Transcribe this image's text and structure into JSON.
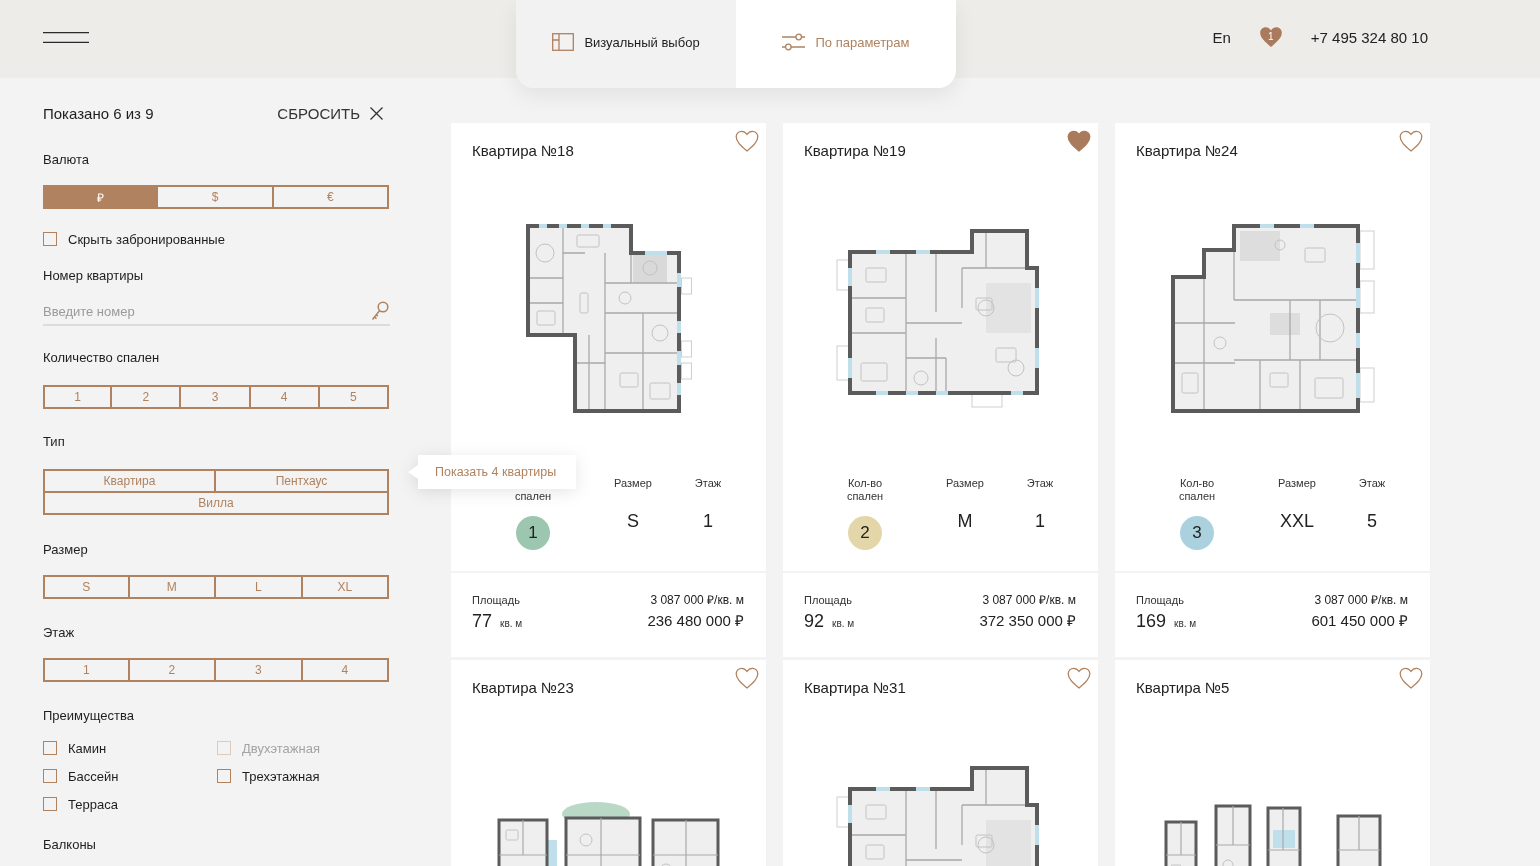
{
  "header": {
    "language": "En",
    "favorites_count": "1",
    "phone": "+7 495 324 80 10"
  },
  "view_tabs": [
    {
      "label": "Визуальный выбор",
      "selected": false
    },
    {
      "label": "По параметрам",
      "selected": true
    }
  ],
  "filters": {
    "summary": "Показано 6 из 9",
    "reset": "СБРОСИТЬ",
    "currency": {
      "label": "Валюта",
      "options": [
        {
          "label": "₽",
          "selected": true
        },
        {
          "label": "$",
          "selected": false
        },
        {
          "label": "€",
          "selected": false
        }
      ]
    },
    "hide_booked": {
      "label": "Скрыть забронированные",
      "checked": false
    },
    "apartment_number": {
      "label": "Номер квартиры",
      "placeholder": "Введите номер"
    },
    "bedrooms": {
      "label": "Количество спален",
      "options": [
        {
          "label": "1",
          "selected": false
        },
        {
          "label": "2",
          "selected": false
        },
        {
          "label": "3",
          "selected": false
        },
        {
          "label": "4",
          "selected": false
        },
        {
          "label": "5",
          "selected": false
        }
      ]
    },
    "type": {
      "label": "Тип",
      "options": [
        {
          "label": "Квартира",
          "selected": false
        },
        {
          "label": "Пентхаус",
          "selected": false
        },
        {
          "label": "Вилла",
          "selected": false
        }
      ]
    },
    "size": {
      "label": "Размер",
      "options": [
        {
          "label": "S",
          "selected": false
        },
        {
          "label": "M",
          "selected": false
        },
        {
          "label": "L",
          "selected": false
        },
        {
          "label": "XL",
          "selected": false
        }
      ]
    },
    "floor": {
      "label": "Этаж",
      "options": [
        {
          "label": "1",
          "selected": false
        },
        {
          "label": "2",
          "selected": false
        },
        {
          "label": "3",
          "selected": false
        },
        {
          "label": "4",
          "selected": false
        }
      ]
    },
    "features": {
      "label": "Преимущества",
      "options": [
        {
          "label": "Камин",
          "checked": false,
          "disabled": false
        },
        {
          "label": "Двухэтажная",
          "checked": false,
          "disabled": true
        },
        {
          "label": "Бассейн",
          "checked": false,
          "disabled": false
        },
        {
          "label": "Трехэтажная",
          "checked": false,
          "disabled": false
        },
        {
          "label": "Терраса",
          "checked": false,
          "disabled": false
        }
      ]
    },
    "balconies": {
      "label": "Балконы"
    }
  },
  "tooltip": {
    "text": "Показать 4 квартиры"
  },
  "cards": [
    {
      "title": "Квартира №18",
      "favorite": false,
      "stats": [
        {
          "kind": "badge",
          "label": "спален",
          "value": "1",
          "color": "#9cc6b0"
        },
        {
          "kind": "text",
          "label": "Размер",
          "value": "S"
        },
        {
          "kind": "text",
          "label": "Этаж",
          "value": "1"
        }
      ],
      "area_label": "Площадь",
      "area": "77",
      "area_unit": "кв. м",
      "price_per_m2": "3 087 000 ₽/кв. м",
      "price": "236 480 000 ₽"
    },
    {
      "title": "Квартира №19",
      "favorite": true,
      "stats": [
        {
          "kind": "badge",
          "label": "Кол-во спален",
          "value": "2",
          "color": "#e3d6a8"
        },
        {
          "kind": "text",
          "label": "Размер",
          "value": "M"
        },
        {
          "kind": "text",
          "label": "Этаж",
          "value": "1"
        }
      ],
      "area_label": "Площадь",
      "area": "92",
      "area_unit": "кв. м",
      "price_per_m2": "3 087 000 ₽/кв. м",
      "price": "372 350 000 ₽"
    },
    {
      "title": "Квартира №24",
      "favorite": false,
      "stats": [
        {
          "kind": "badge",
          "label": "Кол-во спален",
          "value": "3",
          "color": "#aad1dd"
        },
        {
          "kind": "text",
          "label": "Размер",
          "value": "XXL"
        },
        {
          "kind": "text",
          "label": "Этаж",
          "value": "5"
        }
      ],
      "area_label": "Площадь",
      "area": "169",
      "area_unit": "кв. м",
      "price_per_m2": "3 087 000 ₽/кв. м",
      "price": "601 450 000 ₽"
    },
    {
      "title": "Квартира №23",
      "favorite": false
    },
    {
      "title": "Квартира №31",
      "favorite": false
    },
    {
      "title": "Квартира №5",
      "favorite": false
    }
  ]
}
